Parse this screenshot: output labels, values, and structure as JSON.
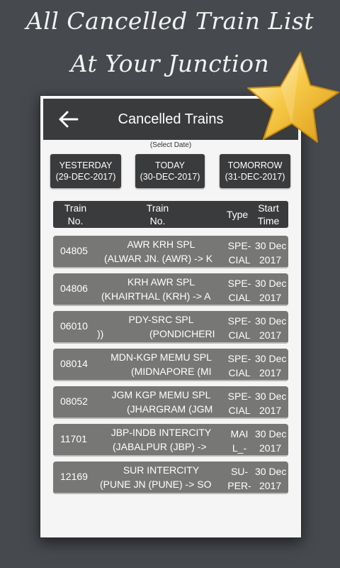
{
  "promo": {
    "line1": "All Cancelled Train List",
    "line2": "At Your Junction"
  },
  "appbar": {
    "title": "Cancelled Trains",
    "back_icon": "arrow-left-icon"
  },
  "select_date_label": "(Select Date)",
  "dates": {
    "yesterday": {
      "label": "YESTERDAY",
      "date": "(29-DEC-2017)"
    },
    "today": {
      "label": "TODAY",
      "date": "(30-DEC-2017)"
    },
    "tomorrow": {
      "label": "TOMORROW",
      "date": "(31-DEC-2017)"
    }
  },
  "table": {
    "headers": {
      "train_no_1": "Train",
      "train_no_2": "No.",
      "name_1": "Train",
      "name_2": "No.",
      "type": "Type",
      "start_1": "Start",
      "start_2": "Time"
    },
    "rows": [
      {
        "number": "04805",
        "name": "AWR KRH SPL",
        "route": "(ALWAR JN. (AWR) -> K",
        "type_1": "SPE-",
        "type_2": "CIAL",
        "start_1": "30 Dec",
        "start_2": "2017"
      },
      {
        "number": "04806",
        "name": "KRH AWR SPL",
        "route": "(KHAIRTHAL (KRH) -> A",
        "type_1": "SPE-",
        "type_2": "CIAL",
        "start_1": "30 Dec",
        "start_2": "2017"
      },
      {
        "number": "06010",
        "name": "PDY-SRC SPL",
        "route": "(PONDICHERI",
        "route_prefix": "))",
        "type_1": "SPE-",
        "type_2": "CIAL",
        "start_1": "30 Dec",
        "start_2": "2017"
      },
      {
        "number": "08014",
        "name": "MDN-KGP MEMU SPL",
        "route": "(MIDNAPORE (MI",
        "type_1": "SPE-",
        "type_2": "CIAL",
        "start_1": "30 Dec",
        "start_2": "2017"
      },
      {
        "number": "08052",
        "name": "JGM KGP MEMU SPL",
        "route": "(JHARGRAM (JGM",
        "type_1": "SPE-",
        "type_2": "CIAL",
        "start_1": "30 Dec",
        "start_2": "2017"
      },
      {
        "number": "11701",
        "name": "JBP-INDB INTERCITY",
        "route": "(JABALPUR (JBP) ->",
        "type_1": "MAI",
        "type_2": "L_-",
        "start_1": "30 Dec",
        "start_2": "2017"
      },
      {
        "number": "12169",
        "name": "SUR INTERCITY",
        "route": "(PUNE JN (PUNE) -> SO",
        "type_1": "SU-",
        "type_2": "PER-",
        "start_1": "30 Dec",
        "start_2": "2017"
      }
    ]
  },
  "colors": {
    "background": "#46494d",
    "appbar": "#3a3b3d",
    "row": "#777775",
    "star": "#f7c948"
  }
}
